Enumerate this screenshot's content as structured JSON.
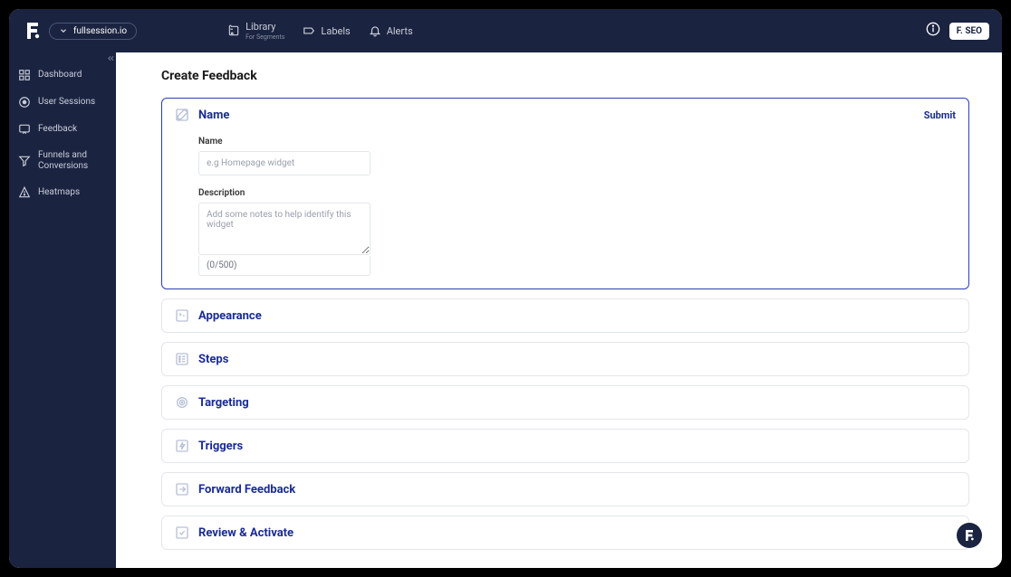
{
  "project_name": "fullsession.io",
  "top_nav": {
    "library": {
      "label": "Library",
      "sub": "For Segments"
    },
    "labels": {
      "label": "Labels"
    },
    "alerts": {
      "label": "Alerts"
    }
  },
  "user_badge": "F. SEO",
  "sidebar": {
    "dashboard": "Dashboard",
    "user_sessions": "User Sessions",
    "feedback": "Feedback",
    "funnels": "Funnels and Conversions",
    "heatmaps": "Heatmaps"
  },
  "page": {
    "title": "Create Feedback"
  },
  "sections": {
    "name": {
      "title": "Name",
      "submit": "Submit"
    },
    "appearance": {
      "title": "Appearance"
    },
    "steps": {
      "title": "Steps"
    },
    "targeting": {
      "title": "Targeting"
    },
    "triggers": {
      "title": "Triggers"
    },
    "forward": {
      "title": "Forward Feedback"
    },
    "review": {
      "title": "Review & Activate"
    }
  },
  "form": {
    "name_label": "Name",
    "name_placeholder": "e.g Homepage widget",
    "name_value": "",
    "desc_label": "Description",
    "desc_placeholder": "Add some notes to help identify this widget",
    "desc_value": "",
    "counter": "(0/500)"
  }
}
